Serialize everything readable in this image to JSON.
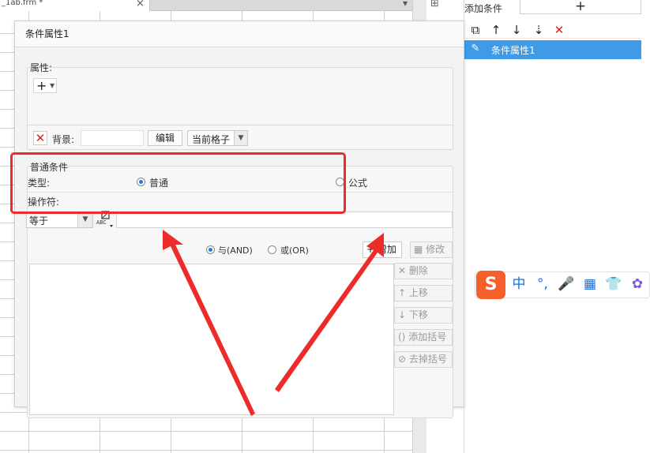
{
  "sheet": {
    "tab_label": "_1ab.frm *",
    "tab_close": "×",
    "tab_menu": "▾",
    "strip_icon": "⊞"
  },
  "right_panel": {
    "title": "添加条件",
    "add_label": "+",
    "toolbar_icons": [
      "copy-icon",
      "arrow-up-icon",
      "arrow-down-icon",
      "move-bottom-icon",
      "delete-icon"
    ],
    "toolbar_glyphs": [
      "⧉",
      "↑",
      "↓",
      "⇣",
      "✕"
    ],
    "item_label": "条件属性1",
    "item_icon": "✎",
    "accent": "#3f9be6"
  },
  "dialog": {
    "title": "条件属性1",
    "attributes": {
      "label": "属性:",
      "add_label": "+",
      "background_label": "背景:",
      "edit_label": "编辑",
      "scope_value": "当前格子"
    },
    "conditions": {
      "label": "普通条件",
      "type_label": "类型:",
      "type_normal": "普通",
      "type_formula": "公式",
      "operator_label": "操作符:",
      "operator_value": "等于",
      "and_label": "与(AND)",
      "or_label": "或(OR)",
      "add_label": "+ 增加",
      "modify_label": "修改",
      "delete_label": "删除",
      "up_label": "上移",
      "down_label": "下移",
      "add_paren_label": "添加括号",
      "remove_paren_label": "去掉括号"
    }
  },
  "annotation": {
    "highlight_color": "#ee2b2b"
  },
  "ime": {
    "logo": "S",
    "items": [
      "中",
      "°,",
      "🎤",
      "▦",
      "👕",
      "✿"
    ]
  }
}
